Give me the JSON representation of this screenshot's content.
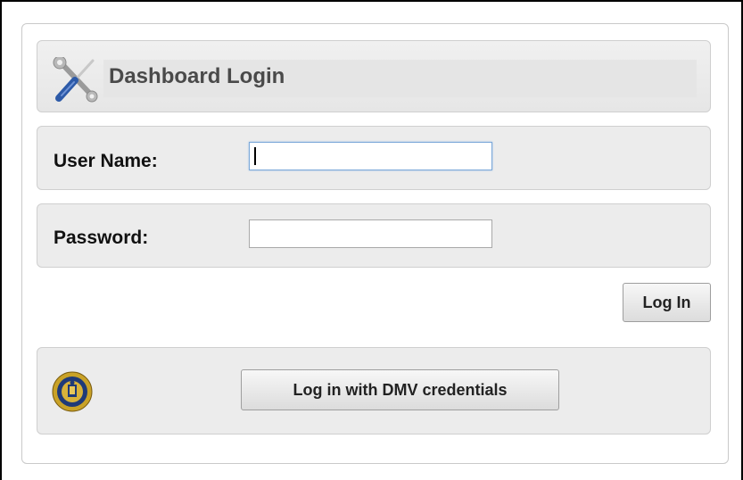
{
  "login_panel": {
    "title": "Dashboard Login",
    "title_icon": "tools-icon"
  },
  "username": {
    "label": "User Name:",
    "value": "",
    "placeholder": ""
  },
  "password": {
    "label": "Password:",
    "value": "",
    "placeholder": ""
  },
  "actions": {
    "login_label": "Log In",
    "dmv_login_label": "Log in with DMV credentials",
    "dmv_icon": "state-seal-icon"
  },
  "colors": {
    "panel_background": "#ececec",
    "title_text": "#4a4a4a",
    "focused_input_border": "#7aa7d8",
    "seal_gold": "#c9a227",
    "seal_blue": "#1f3a78",
    "tool_handle_blue": "#2d5aa8"
  }
}
